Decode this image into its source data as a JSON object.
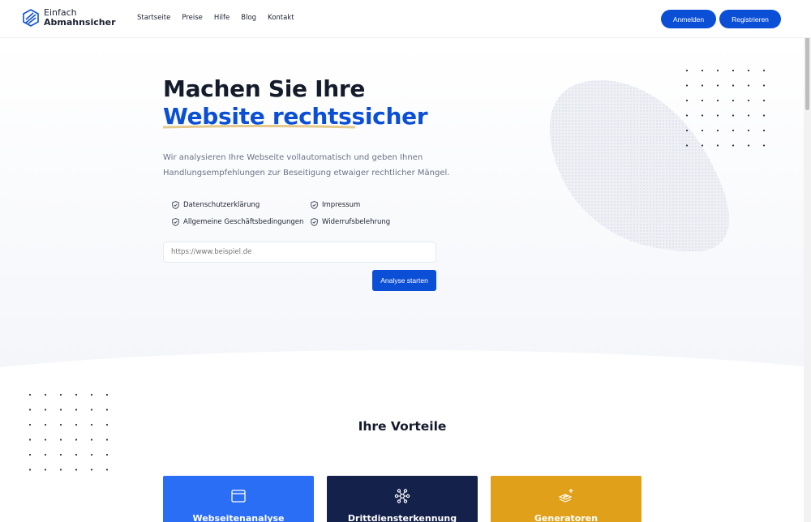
{
  "header": {
    "logo_line1": "Einfach",
    "logo_line2": "Abmahnsicher",
    "nav": [
      "Startseite",
      "Preise",
      "Hilfe",
      "Blog",
      "Kontakt"
    ],
    "login_label": "Anmelden",
    "register_label": "Registrieren"
  },
  "hero": {
    "title_line1": "Machen Sie Ihre",
    "title_line2": "Website rechtssicher",
    "description": "Wir analysieren Ihre Webseite vollautomatisch und geben Ihnen Handlungsempfehlungen zur Beseitigung etwaiger rechtlicher Mängel.",
    "checks": [
      "Datenschutzerklärung",
      "Impressum",
      "Allgemeine Geschäftsbedingungen",
      "Widerrufsbelehrung"
    ],
    "url_placeholder": "https://www.beispiel.de",
    "analyse_label": "Analyse starten"
  },
  "benefits": {
    "title": "Ihre Vorteile",
    "cards": [
      {
        "title": "Webseitenanalyse",
        "icon": "browser-window-icon",
        "color": "#2a6ef5"
      },
      {
        "title": "Drittdiensterkennung",
        "icon": "network-nodes-icon",
        "color": "#14214a"
      },
      {
        "title": "Generatoren",
        "icon": "layers-sparkle-icon",
        "color": "#e0a019"
      }
    ]
  },
  "colors": {
    "primary": "#0a4fd6",
    "accent_underline": "#e3c98a"
  }
}
